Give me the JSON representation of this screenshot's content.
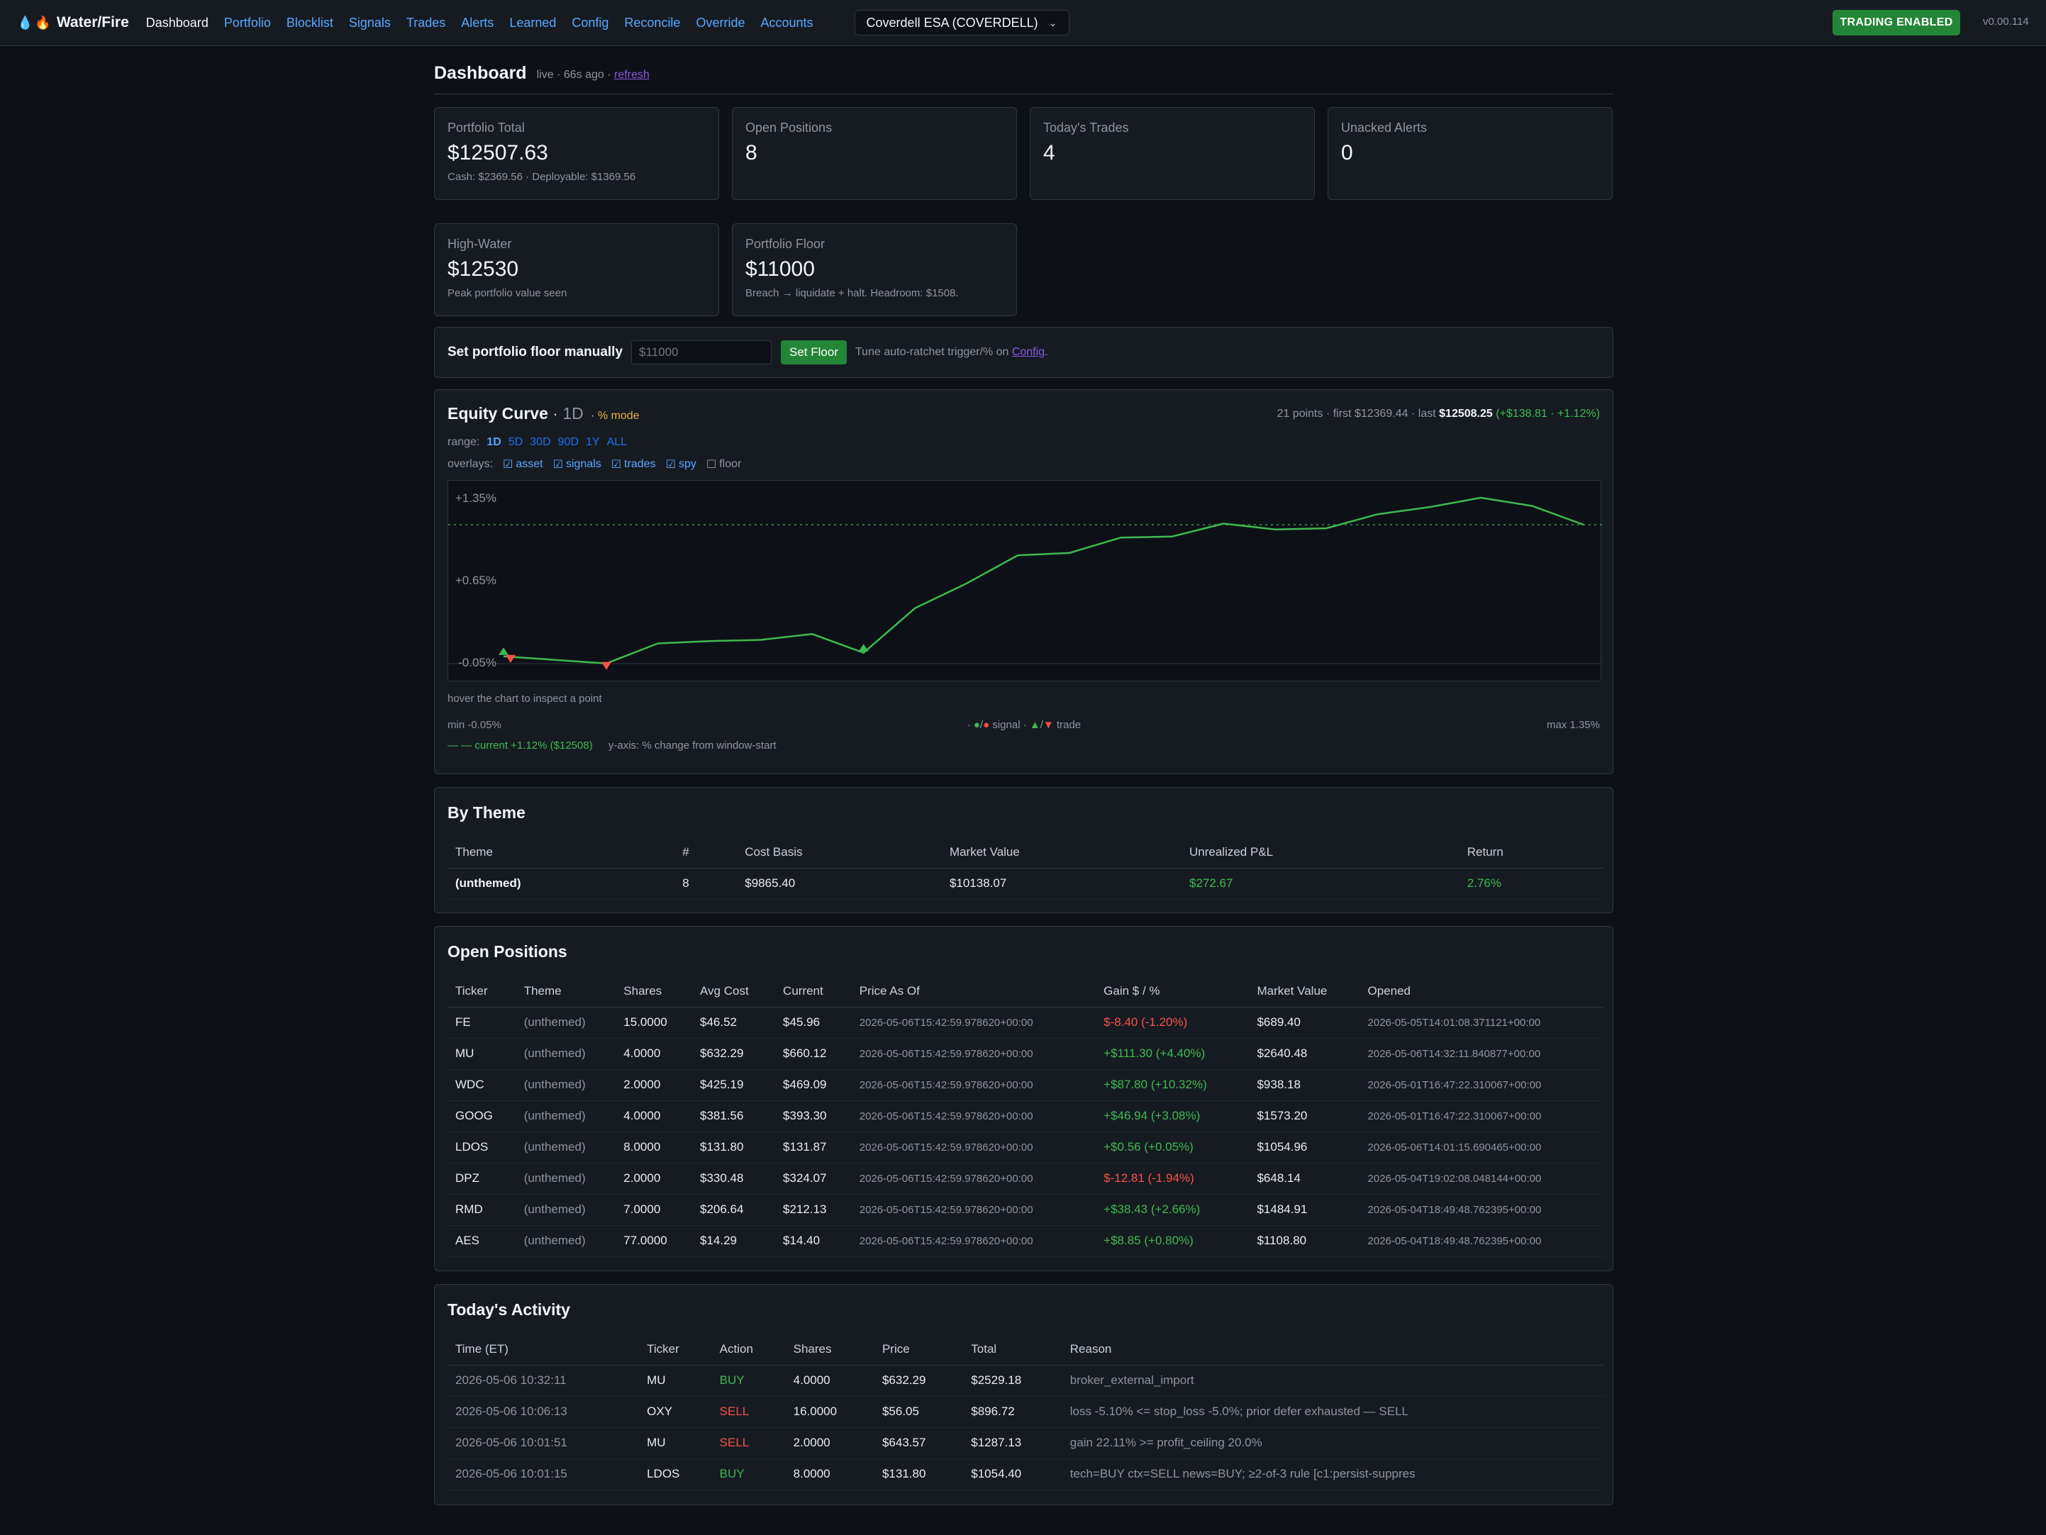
{
  "app": {
    "name": "Water/Fire",
    "version": "v0.00.114"
  },
  "nav": {
    "items": [
      {
        "label": "Dashboard",
        "active": true
      },
      {
        "label": "Portfolio"
      },
      {
        "label": "Blocklist"
      },
      {
        "label": "Signals"
      },
      {
        "label": "Trades"
      },
      {
        "label": "Alerts"
      },
      {
        "label": "Learned"
      },
      {
        "label": "Config"
      },
      {
        "label": "Reconcile"
      },
      {
        "label": "Override"
      },
      {
        "label": "Accounts"
      }
    ],
    "account_selected": "Coverdell ESA (COVERDELL)",
    "trading_status": "TRADING ENABLED"
  },
  "header": {
    "title": "Dashboard",
    "meta": "live · 66s ago ·",
    "refresh": "refresh"
  },
  "stats": [
    {
      "label": "Portfolio Total",
      "value": "$12507.63",
      "sub": "Cash: $2369.56 · Deployable: $1369.56"
    },
    {
      "label": "Open Positions",
      "value": "8",
      "sub": ""
    },
    {
      "label": "Today's Trades",
      "value": "4",
      "sub": ""
    },
    {
      "label": "Unacked Alerts",
      "value": "0",
      "sub": ""
    },
    {
      "label": "High-Water",
      "value": "$12530",
      "sub": "Peak portfolio value seen"
    },
    {
      "label": "Portfolio Floor",
      "value": "$11000",
      "sub": "Breach → liquidate + halt. Headroom: $1508."
    }
  ],
  "floor_form": {
    "label": "Set portfolio floor manually",
    "placeholder": "$11000",
    "button": "Set Floor",
    "note": "Tune auto-ratchet trigger/% on",
    "note_link": "Config",
    "note_end": "."
  },
  "equity": {
    "title": "Equity Curve",
    "sep": "·",
    "range_label": "1D",
    "mode": "· % mode",
    "summary_prefix": "21 points · first $12369.44 · last",
    "summary_last": "$12508.25",
    "summary_change": "(+$138.81 · +1.12%)",
    "range_title": "range:",
    "ranges": [
      "1D",
      "5D",
      "30D",
      "90D",
      "1Y",
      "ALL"
    ],
    "overlays_title": "overlays:",
    "overlays": [
      {
        "label": "asset",
        "checked": true,
        "box": "☑"
      },
      {
        "label": "signals",
        "checked": true,
        "box": "☑"
      },
      {
        "label": "trades",
        "checked": true,
        "box": "☑"
      },
      {
        "label": "spy",
        "checked": true,
        "box": "☑"
      },
      {
        "label": "floor",
        "checked": false,
        "box": "☐"
      }
    ],
    "hint": "hover the chart to inspect a point",
    "min_text": "min -0.05%",
    "max_text": "max 1.35%",
    "legend_signal": "signal",
    "legend_trade": "trade",
    "current_text": "— — current +1.12% ($12508)",
    "yaxis_note": "y-axis: % change from window-start"
  },
  "chart_data": {
    "type": "line",
    "title": "Equity Curve",
    "ylabel": "% change from window-start",
    "y_ticks": [
      "+1.35%",
      "+0.65%",
      "-0.05%"
    ],
    "ylim": [
      -0.05,
      1.35
    ],
    "current_line": 1.12,
    "color": "#3fb950",
    "series": [
      {
        "values": [
          0.0,
          -0.03,
          -0.06,
          0.11,
          0.13,
          0.14,
          0.19,
          0.03,
          0.41,
          0.62,
          0.86,
          0.88,
          1.01,
          1.02,
          1.13,
          1.08,
          1.09,
          1.21,
          1.27,
          1.35,
          1.28,
          1.12
        ]
      }
    ],
    "markers": [
      {
        "point": 0,
        "kind": "trade-up"
      },
      {
        "point": 0,
        "kind": "trade-down"
      },
      {
        "point": 2,
        "kind": "trade-down"
      },
      {
        "point": 7,
        "kind": "trade-up"
      }
    ]
  },
  "by_theme": {
    "title": "By Theme",
    "columns": [
      "Theme",
      "#",
      "Cost Basis",
      "Market Value",
      "Unrealized P&L",
      "Return"
    ],
    "rows": [
      [
        "(unthemed)",
        "8",
        "$9865.40",
        "$10138.07",
        "$272.67",
        "2.76%"
      ]
    ]
  },
  "positions": {
    "title": "Open Positions",
    "columns": [
      "Ticker",
      "Theme",
      "Shares",
      "Avg Cost",
      "Current",
      "Price As Of",
      "Gain $ / %",
      "Market Value",
      "Opened"
    ],
    "rows": [
      [
        "FE",
        "(unthemed)",
        "15.0000",
        "$46.52",
        "$45.96",
        "2026-05-06T15:42:59.978620+00:00",
        "$-8.40 (-1.20%)",
        "$689.40",
        "2026-05-05T14:01:08.371121+00:00"
      ],
      [
        "MU",
        "(unthemed)",
        "4.0000",
        "$632.29",
        "$660.12",
        "2026-05-06T15:42:59.978620+00:00",
        "+$111.30 (+4.40%)",
        "$2640.48",
        "2026-05-06T14:32:11.840877+00:00"
      ],
      [
        "WDC",
        "(unthemed)",
        "2.0000",
        "$425.19",
        "$469.09",
        "2026-05-06T15:42:59.978620+00:00",
        "+$87.80 (+10.32%)",
        "$938.18",
        "2026-05-01T16:47:22.310067+00:00"
      ],
      [
        "GOOG",
        "(unthemed)",
        "4.0000",
        "$381.56",
        "$393.30",
        "2026-05-06T15:42:59.978620+00:00",
        "+$46.94 (+3.08%)",
        "$1573.20",
        "2026-05-01T16:47:22.310067+00:00"
      ],
      [
        "LDOS",
        "(unthemed)",
        "8.0000",
        "$131.80",
        "$131.87",
        "2026-05-06T15:42:59.978620+00:00",
        "+$0.56 (+0.05%)",
        "$1054.96",
        "2026-05-06T14:01:15.690465+00:00"
      ],
      [
        "DPZ",
        "(unthemed)",
        "2.0000",
        "$330.48",
        "$324.07",
        "2026-05-06T15:42:59.978620+00:00",
        "$-12.81 (-1.94%)",
        "$648.14",
        "2026-05-04T19:02:08.048144+00:00"
      ],
      [
        "RMD",
        "(unthemed)",
        "7.0000",
        "$206.64",
        "$212.13",
        "2026-05-06T15:42:59.978620+00:00",
        "+$38.43 (+2.66%)",
        "$1484.91",
        "2026-05-04T18:49:48.762395+00:00"
      ],
      [
        "AES",
        "(unthemed)",
        "77.0000",
        "$14.29",
        "$14.40",
        "2026-05-06T15:42:59.978620+00:00",
        "+$8.85 (+0.80%)",
        "$1108.80",
        "2026-05-04T18:49:48.762395+00:00"
      ]
    ],
    "gain_sign": [
      "neg",
      "pos",
      "pos",
      "pos",
      "pos",
      "neg",
      "pos",
      "pos"
    ]
  },
  "activity": {
    "title": "Today's Activity",
    "columns": [
      "Time (ET)",
      "Ticker",
      "Action",
      "Shares",
      "Price",
      "Total",
      "Reason"
    ],
    "rows": [
      [
        "2026-05-06 10:32:11",
        "MU",
        "BUY",
        "4.0000",
        "$632.29",
        "$2529.18",
        "broker_external_import"
      ],
      [
        "2026-05-06 10:06:13",
        "OXY",
        "SELL",
        "16.0000",
        "$56.05",
        "$896.72",
        "loss -5.10% <= stop_loss -5.0%; prior defer exhausted — SELL"
      ],
      [
        "2026-05-06 10:01:51",
        "MU",
        "SELL",
        "2.0000",
        "$643.57",
        "$1287.13",
        "gain 22.11% >= profit_ceiling 20.0%"
      ],
      [
        "2026-05-06 10:01:15",
        "LDOS",
        "BUY",
        "8.0000",
        "$131.80",
        "$1054.40",
        "tech=BUY ctx=SELL news=BUY; ≥2-of-3 rule [c1:persist-suppres"
      ]
    ]
  },
  "colors": {
    "positive": "#3fb950",
    "negative": "#f85149",
    "accent": "#58a6ff",
    "badge": "#238636"
  }
}
